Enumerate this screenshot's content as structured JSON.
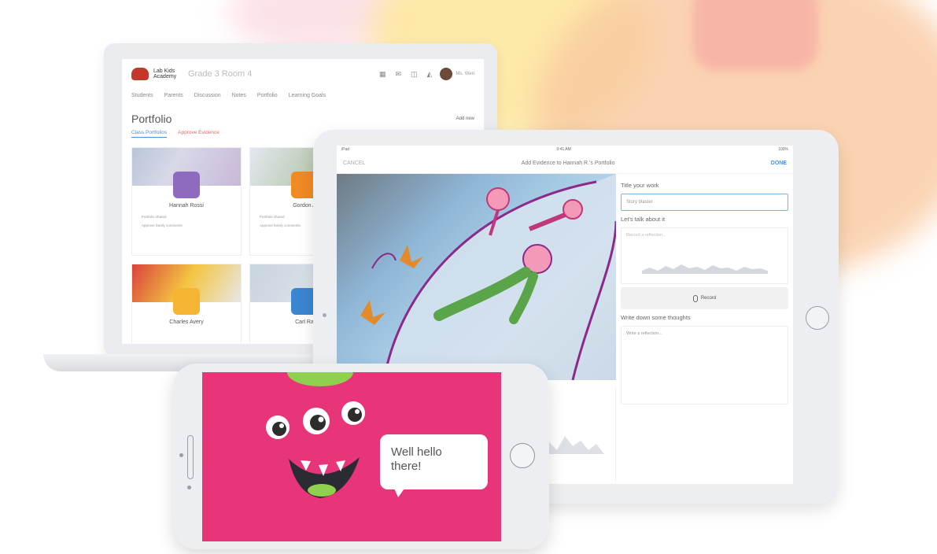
{
  "laptop": {
    "brand": "Lab Kids Academy",
    "class_name": "Grade 3 Room 4",
    "user": "Ms. Wen",
    "nav": [
      "Students",
      "Parents",
      "Discussion",
      "Notes",
      "Portfolio",
      "Learning Goals"
    ],
    "page_title": "Portfolio",
    "add_button": "Add new",
    "tabs": [
      "Class Portfolios",
      "Approve Evidence"
    ],
    "students": [
      {
        "name": "Hannah Rossi",
        "color": "#8e6bbf"
      },
      {
        "name": "Gordon A",
        "color": "#f08a24"
      },
      {
        "name": "Charles Avery",
        "color": "#f5b431"
      },
      {
        "name": "Carl Ra",
        "color": "#3a86cf"
      }
    ],
    "card_meta_1": "Portfolio shared",
    "card_meta_2": "Approve family comments"
  },
  "tablet": {
    "status_time": "9:41 AM",
    "status_battery": "100%",
    "status_left": "iPad",
    "cancel": "CANCEL",
    "heading": "Add Evidence to Hannah R.'s Portfolio",
    "done": "DONE",
    "title_label": "Title your work",
    "title_value": "Story blaster",
    "talk_label": "Let's talk about it",
    "reflection_placeholder": "Record a reflection...",
    "record_button": "Record",
    "write_label": "Write down some thoughts",
    "write_placeholder": "Write a reflection..."
  },
  "phone": {
    "speech": "Well hello there!"
  }
}
